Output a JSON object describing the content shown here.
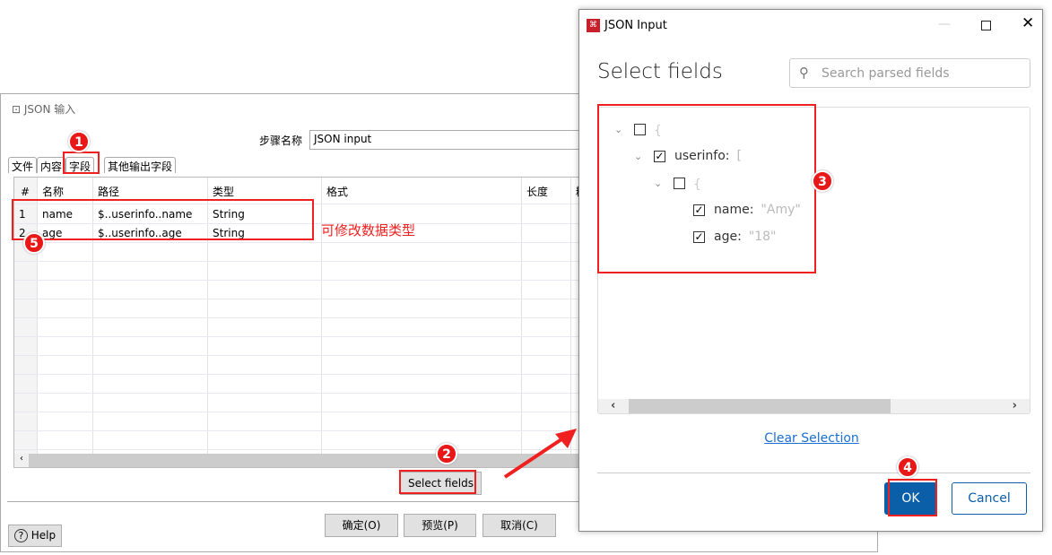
{
  "back_dialog": {
    "title": "JSON 输入",
    "step_name_label": "步骤名称",
    "step_name_value": "JSON input",
    "tabs": [
      {
        "label": "文件"
      },
      {
        "label": "内容"
      },
      {
        "label": "字段",
        "active": true
      },
      {
        "label": "其他输出字段"
      }
    ],
    "columns": [
      "#",
      "名称",
      "路径",
      "类型",
      "格式",
      "长度",
      "精"
    ],
    "rows": [
      {
        "num": "1",
        "name": "name",
        "path": "$..userinfo..name",
        "type": "String"
      },
      {
        "num": "2",
        "name": "age",
        "path": "$..userinfo..age",
        "type": "String"
      }
    ],
    "select_fields_label": "Select fields",
    "ok_label": "确定(O)",
    "preview_label": "预览(P)",
    "cancel_label": "取消(C)",
    "help_label": "Help",
    "annotation_note": "可修改数据类型"
  },
  "front_dialog": {
    "title": "JSON Input",
    "heading": "Select fields",
    "search_placeholder": "Search parsed fields",
    "tree": {
      "root_brace": "{",
      "userinfo_key": "userinfo:",
      "userinfo_bracket": "[",
      "item_brace": "{",
      "name_key": "name:",
      "name_value": "\"Amy\"",
      "age_key": "age:",
      "age_value": "\"18\""
    },
    "tree_checked": {
      "root": false,
      "userinfo": true,
      "item": false,
      "name": true,
      "age": true
    },
    "clear_selection_label": "Clear Selection",
    "ok_label": "OK",
    "cancel_label": "Cancel"
  },
  "annotations": [
    "1",
    "2",
    "3",
    "4",
    "5"
  ],
  "colors": {
    "accent": "#0b5fa8",
    "annotation": "#e81818",
    "link": "#1a6fd0"
  }
}
